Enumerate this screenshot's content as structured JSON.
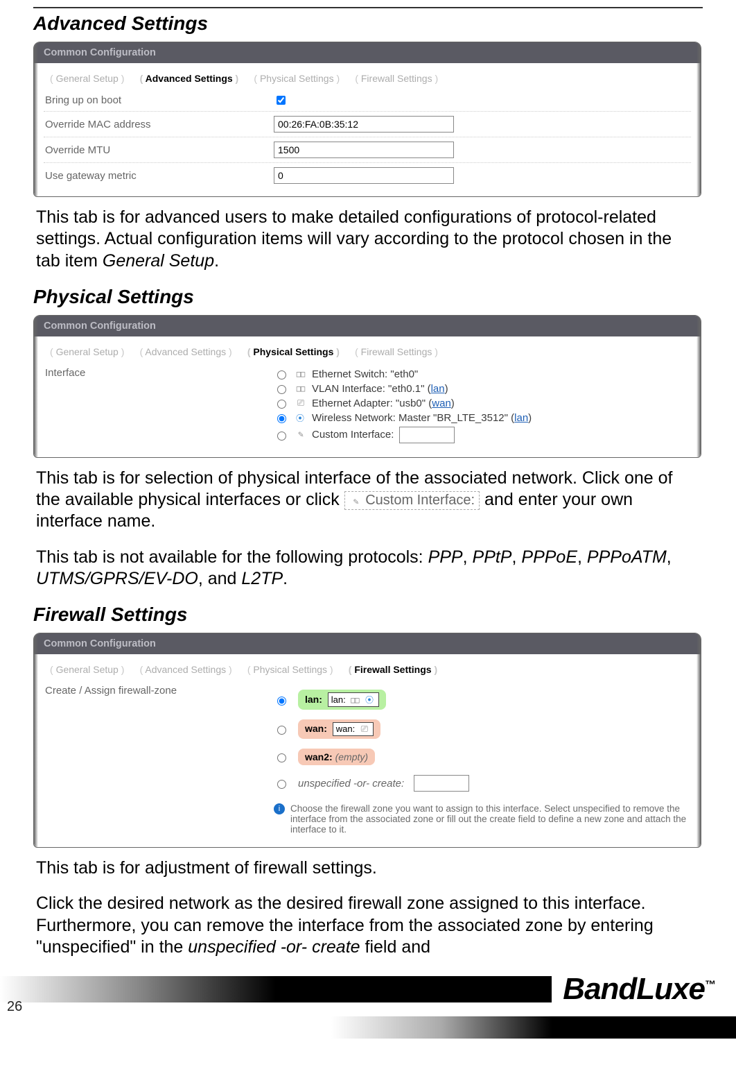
{
  "page_number": "26",
  "brand_name": "BandLuxe",
  "brand_tm": "™",
  "sections": {
    "advanced": {
      "title": "Advanced Settings",
      "panel_title": "Common Configuration",
      "tabs": {
        "general": "General Setup",
        "advanced": "Advanced Settings",
        "physical": "Physical Settings",
        "firewall": "Firewall Settings"
      },
      "rows": {
        "bring_up": "Bring up on boot",
        "mac": "Override MAC address",
        "mac_value": "00:26:FA:0B:35:12",
        "mtu": "Override MTU",
        "mtu_value": "1500",
        "metric": "Use gateway metric",
        "metric_value": "0"
      },
      "paragraph_a": "This tab is for advanced users to make detailed configurations of protocol-related settings. Actual configuration items will vary according to the protocol chosen in the tab item ",
      "paragraph_a_em": "General Setup",
      "paragraph_a_end": "."
    },
    "physical": {
      "title": "Physical Settings",
      "panel_title": "Common Configuration",
      "tabs": {
        "general": "General Setup",
        "advanced": "Advanced Settings",
        "physical": "Physical Settings",
        "firewall": "Firewall Settings"
      },
      "row_label": "Interface",
      "ifaces": {
        "eth0": "Ethernet Switch: \"eth0\"",
        "vlan_pre": "VLAN Interface: \"eth0.1\" (",
        "vlan_link": "lan",
        "usb_pre": "Ethernet Adapter: \"usb0\" (",
        "usb_link": "wan",
        "wl_pre": "Wireless Network: Master \"BR_LTE_3512\" (",
        "wl_link": "lan",
        "custom": "Custom Interface:"
      },
      "paragraph_b1": "This tab is for selection of physical interface of the associated network. Click one of the available physical interfaces or click ",
      "paragraph_b_inline": "Custom Interface:",
      "paragraph_b2": " and enter your own interface name.",
      "paragraph_c1": "This tab is not available for the following protocols: ",
      "protos": {
        "p1": "PPP",
        "p2": "PPtP",
        "p3": "PPPoE",
        "p4": "PPPoATM",
        "p5": "UTMS/GPRS/EV-DO",
        "p6": "L2TP"
      },
      "sep": ", ",
      "and": ", and ",
      "period": "."
    },
    "firewall": {
      "title": "Firewall Settings",
      "panel_title": "Common Configuration",
      "tabs": {
        "general": "General Setup",
        "advanced": "Advanced Settings",
        "physical": "Physical Settings",
        "firewall": "Firewall Settings"
      },
      "row_label": "Create / Assign firewall-zone",
      "zones": {
        "lan_label": "lan:",
        "lan_chip": "lan:",
        "wan_label": "wan:",
        "wan_chip": "wan:",
        "wan2_label": "wan2:",
        "wan2_chip": "(empty)",
        "unspec": "unspecified -or- create:"
      },
      "help": "Choose the firewall zone you want to assign to this interface. Select unspecified to remove the interface from the associated zone or fill out the create field to define a new zone and attach the interface to it.",
      "paragraph_d": "This tab is for adjustment of firewall settings.",
      "paragraph_e1": "Click the desired network as the desired firewall zone assigned to this interface. Furthermore, you can remove the interface from the associated zone by entering \"unspecified\" in the ",
      "paragraph_e_em": "unspecified -or- create",
      "paragraph_e2": " field and"
    }
  }
}
